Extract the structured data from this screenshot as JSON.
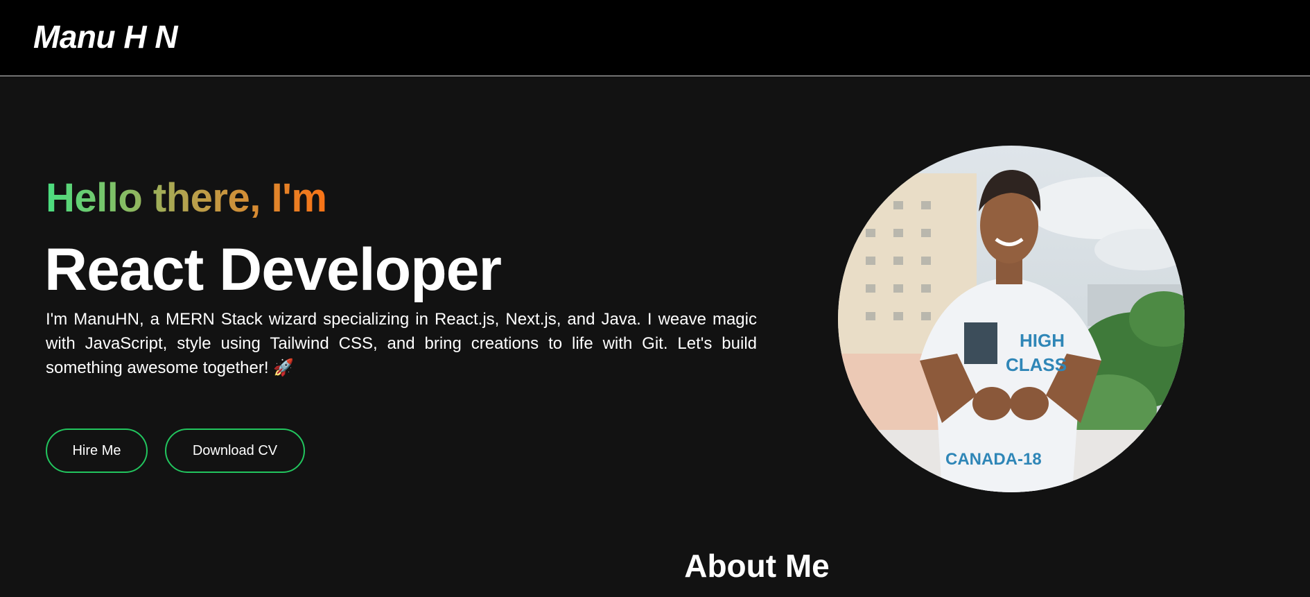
{
  "nav": {
    "brand": "Manu H N"
  },
  "hero": {
    "greeting": "Hello there, I'm",
    "role": "React Developer",
    "bio": "I'm ManuHN, a MERN Stack wizard specializing in React.js, Next.js, and Java. I weave magic with JavaScript, style using Tailwind CSS, and bring creations to life with Git. Let's build something awesome together! 🚀",
    "buttons": {
      "hire": "Hire Me",
      "cv": "Download CV"
    },
    "photo": {
      "shirt_text": [
        "HIGH",
        "CLASS",
        "CANADA-18"
      ]
    }
  },
  "about": {
    "title": "About Me"
  },
  "colors": {
    "background": "#121212",
    "navbar": "#000000",
    "accent_green": "#22c55e",
    "gradient_start": "#4ade80",
    "gradient_end": "#f97316"
  }
}
